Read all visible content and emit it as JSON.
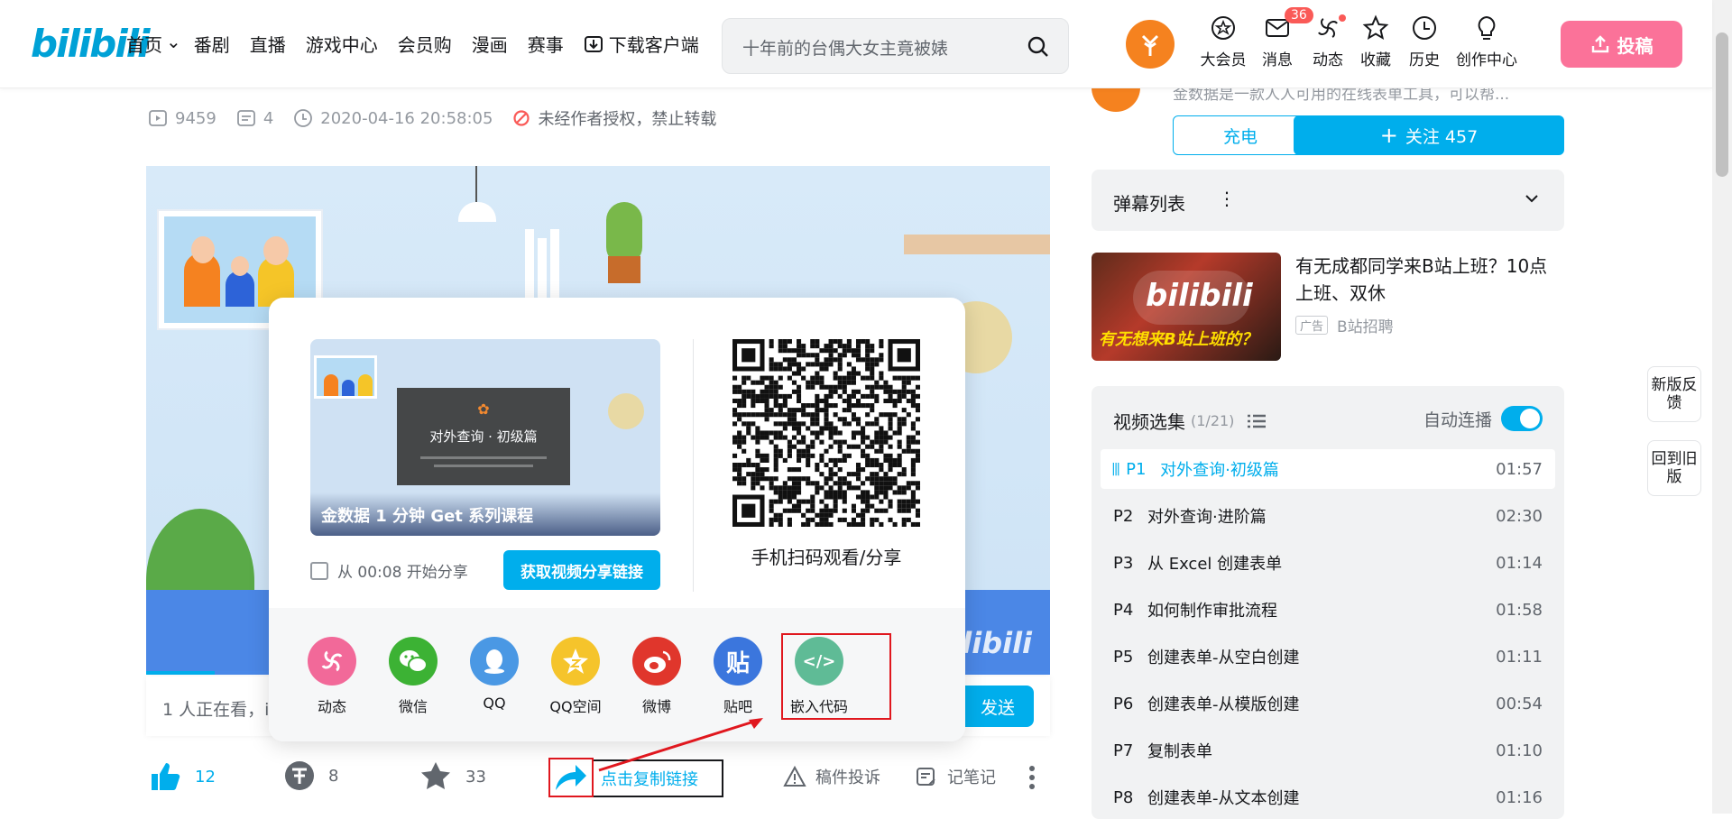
{
  "header": {
    "logo": "bilibili",
    "nav": [
      "首页",
      "番剧",
      "直播",
      "游戏中心",
      "会员购",
      "漫画",
      "赛事",
      "下载客户端"
    ],
    "search_placeholder": "十年前的台偶大女主竟被婊",
    "icons": [
      {
        "label": "大会员",
        "icon": "vip-icon"
      },
      {
        "label": "消息",
        "icon": "message-icon",
        "badge": "36"
      },
      {
        "label": "动态",
        "icon": "dynamic-icon"
      },
      {
        "label": "收藏",
        "icon": "star-icon"
      },
      {
        "label": "历史",
        "icon": "clock-icon"
      },
      {
        "label": "创作中心",
        "icon": "bulb-icon"
      }
    ],
    "upload": "投稿"
  },
  "video": {
    "views": "9459",
    "danmaku": "4",
    "date": "2020-04-16 20:58:05",
    "copyright": "未经作者授权，禁止转载",
    "viewers": "1 人正在看，i",
    "send": "发送"
  },
  "actions": {
    "likes": "12",
    "coins": "8",
    "favorites": "33",
    "copy_link": "点击复制链接",
    "report": "稿件投诉",
    "notes": "记笔记"
  },
  "share": {
    "thumb_caption": "金数据 1 分钟 Get 系列课程",
    "thumb_overlay_title": "对外查询 · 初级篇",
    "start_from": "从 00:08 开始分享",
    "get_link": "获取视频分享链接",
    "qr_label": "手机扫码观看/分享",
    "targets": [
      {
        "label": "动态",
        "color": "#f26999",
        "glyph": "✿"
      },
      {
        "label": "微信",
        "color": "#3cb234",
        "glyph": "●"
      },
      {
        "label": "QQ",
        "color": "#4a98e4",
        "glyph": "Q"
      },
      {
        "label": "QQ空间",
        "color": "#f5c42b",
        "glyph": "★"
      },
      {
        "label": "微博",
        "color": "#e0362c",
        "glyph": "◉"
      },
      {
        "label": "贴吧",
        "color": "#3b76dd",
        "glyph": "贴"
      },
      {
        "label": "嵌入代码",
        "color": "#5fbb96",
        "glyph": "</>"
      }
    ]
  },
  "up": {
    "desc": "金数据是一款人人可用的在线表单工具，可以帮...",
    "charge": "充电",
    "follow": "关注 457"
  },
  "danmaku_list": {
    "title": "弹幕列表"
  },
  "ad": {
    "title": "有无成都同学来B站上班？10点上班、双休",
    "tag": "广告",
    "source": "B站招聘",
    "image_caption": "有无想来B站上班的？",
    "image_logo": "bilibili"
  },
  "playlist": {
    "title": "视频选集",
    "count": "(1/21)",
    "autoplay": "自动连播",
    "episodes": [
      {
        "p": "P1",
        "name": "对外查询·初级篇",
        "dur": "01:57"
      },
      {
        "p": "P2",
        "name": "对外查询·进阶篇",
        "dur": "02:30"
      },
      {
        "p": "P3",
        "name": "从 Excel 创建表单",
        "dur": "01:14"
      },
      {
        "p": "P4",
        "name": "如何制作审批流程",
        "dur": "01:58"
      },
      {
        "p": "P5",
        "name": "创建表单-从空白创建",
        "dur": "01:11"
      },
      {
        "p": "P6",
        "name": "创建表单-从模版创建",
        "dur": "00:54"
      },
      {
        "p": "P7",
        "name": "复制表单",
        "dur": "01:10"
      },
      {
        "p": "P8",
        "name": "创建表单-从文本创建",
        "dur": "01:16"
      }
    ]
  },
  "side": {
    "feedback": "新版反馈",
    "old": "回到旧版"
  }
}
